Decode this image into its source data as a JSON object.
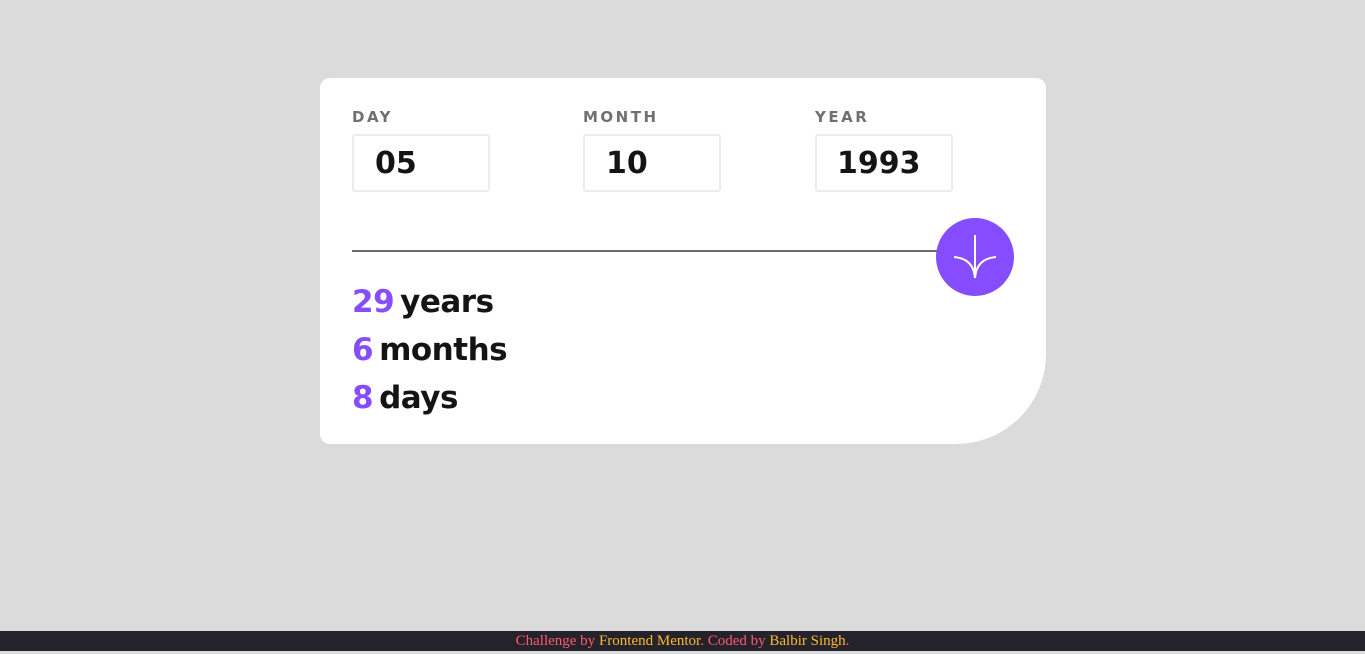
{
  "form": {
    "day": {
      "label": "DAY",
      "value": "05"
    },
    "month": {
      "label": "MONTH",
      "value": "10"
    },
    "year": {
      "label": "YEAR",
      "value": "1993"
    }
  },
  "submit": {
    "icon": "arrow-down-icon"
  },
  "results": {
    "years": {
      "value": "29",
      "unit": "years"
    },
    "months": {
      "value": "6",
      "unit": "months"
    },
    "days": {
      "value": "8",
      "unit": "days"
    }
  },
  "footer": {
    "prefix": "Challenge by ",
    "challenge_link": "Frontend Mentor",
    "middle": ". Coded by ",
    "author_link": "Balbir Singh",
    "suffix": "."
  },
  "colors": {
    "accent": "#854dff",
    "background": "#dbdbdb",
    "card": "#ffffff",
    "footer_bg": "#24232b",
    "footer_text": "#ff5a6e",
    "footer_link": "#ffb833"
  }
}
